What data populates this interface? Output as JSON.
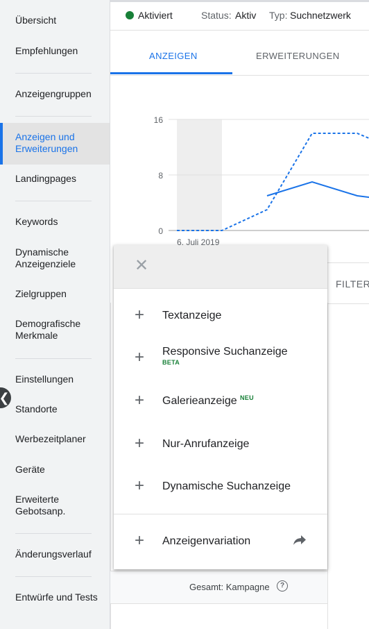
{
  "sidebar": {
    "items": [
      {
        "label": "Übersicht"
      },
      {
        "label": "Empfehlungen"
      },
      {
        "label": "Anzeigengruppen"
      },
      {
        "label": "Anzeigen und Erweiterungen",
        "active": true
      },
      {
        "label": "Landingpages"
      },
      {
        "label": "Keywords"
      },
      {
        "label": "Dynamische Anzeigenziele"
      },
      {
        "label": "Zielgruppen"
      },
      {
        "label": "Demografische Merkmale"
      },
      {
        "label": "Einstellungen"
      },
      {
        "label": "Standorte"
      },
      {
        "label": "Werbezeitplaner"
      },
      {
        "label": "Geräte"
      },
      {
        "label": "Erweiterte Gebotsanp."
      },
      {
        "label": "Änderungsverlauf"
      },
      {
        "label": "Entwürfe und Tests"
      }
    ]
  },
  "header": {
    "status_value": "Aktiviert",
    "status_label": "Status:",
    "status_state": "Aktiv",
    "type_label": "Typ:",
    "type_value": "Suchnetzwerk"
  },
  "tabs": [
    {
      "label": "ANZEIGEN",
      "active": true
    },
    {
      "label": "ERWEITERUNGEN"
    }
  ],
  "chart_data": {
    "type": "line",
    "y_ticks": [
      "16",
      "8",
      "0"
    ],
    "ylim": [
      0,
      16
    ],
    "x_tick_label": "6. Juli 2019",
    "series": [
      {
        "style": "dashed",
        "color": "#1a73e8",
        "values": [
          0,
          0,
          3,
          14,
          14,
          13
        ]
      },
      {
        "style": "solid",
        "color": "#1a73e8",
        "values": [
          null,
          null,
          5,
          7,
          5,
          4.7
        ]
      }
    ]
  },
  "filter_label": "FILTER",
  "total_label": "Gesamt: Kampagne",
  "menu": {
    "items": [
      {
        "label": "Textanzeige"
      },
      {
        "label": "Responsive Suchanzeige",
        "badge": "BETA"
      },
      {
        "label": "Galerieanzeige",
        "badge": "NEU"
      },
      {
        "label": "Nur-Anrufanzeige"
      },
      {
        "label": "Dynamische Suchanzeige"
      },
      {
        "label": "Anzeigenvariation"
      }
    ]
  },
  "colors": {
    "accent": "#1a73e8",
    "status_green": "#188038"
  }
}
